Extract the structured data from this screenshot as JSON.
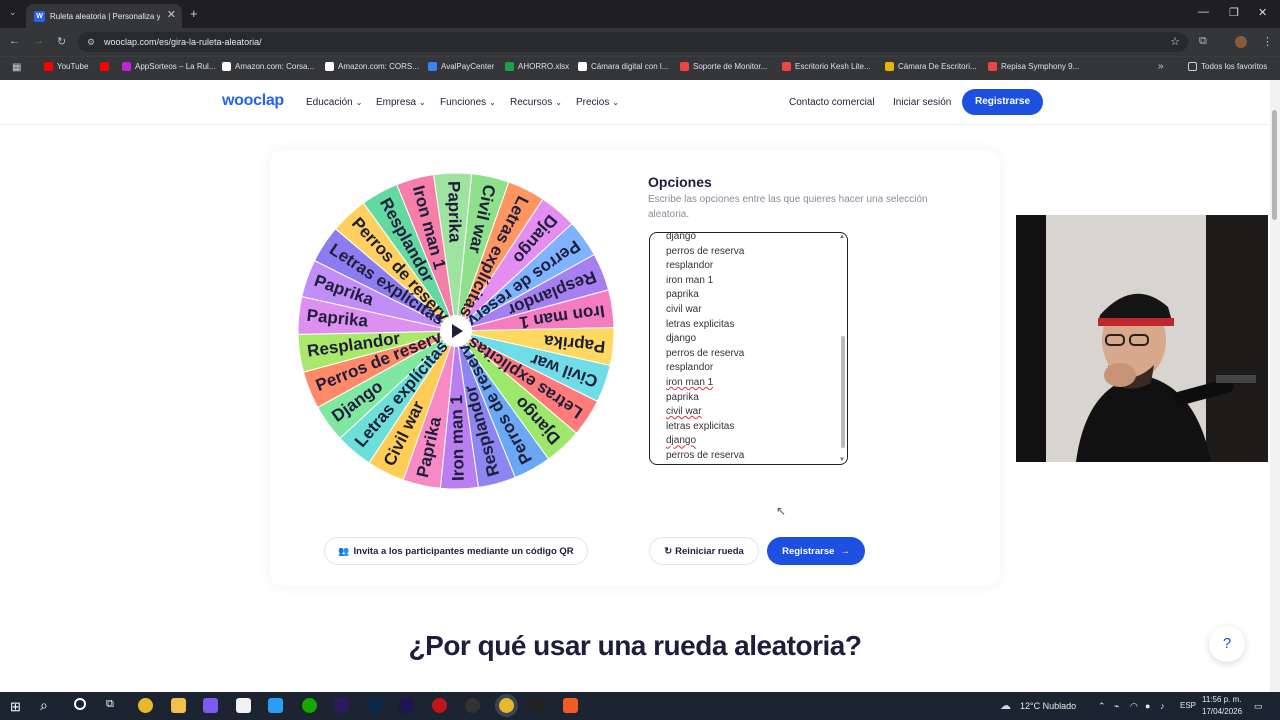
{
  "browser": {
    "tab_title": "Ruleta aleatoria | Personaliza y...",
    "tab_favicon": "W",
    "url": "wooclap.com/es/gira-la-ruleta-aleatoria/",
    "bookmarks": [
      {
        "label": "YouTube",
        "color": "#ff0000"
      },
      {
        "label": "",
        "color": "#ff0000"
      },
      {
        "label": "AppSorteos – La Rul...",
        "color": "#c026d3"
      },
      {
        "label": "Amazon.com: Corsa...",
        "color": "#ffffff"
      },
      {
        "label": "Amazon.com: CORS...",
        "color": "#ffffff"
      },
      {
        "label": "AvalPayCenter",
        "color": "#3b82f6"
      },
      {
        "label": "AHORRO.xlsx",
        "color": "#16a34a"
      },
      {
        "label": "Cámara digital con l...",
        "color": "#ffffff"
      },
      {
        "label": "Soporte de Monitor...",
        "color": "#ef4444"
      },
      {
        "label": "Escritorio Kesh Lite...",
        "color": "#ef4444"
      },
      {
        "label": "Cámara De Escritori...",
        "color": "#eab308"
      },
      {
        "label": "Repisa Symphony 9...",
        "color": "#ef4444"
      }
    ],
    "all_favorites": "Todos los favoritos"
  },
  "nav": {
    "logo": "wooclap",
    "items": [
      "Educación",
      "Empresa",
      "Funciones",
      "Recursos",
      "Precios"
    ],
    "contact": "Contacto comercial",
    "login": "Iniciar sesión",
    "register": "Registrarse"
  },
  "wheel": {
    "segments": [
      {
        "label": "Civil war",
        "color": "#8fe08a"
      },
      {
        "label": "Letras explícitas",
        "color": "#ff9560"
      },
      {
        "label": "Django",
        "color": "#e38ef0"
      },
      {
        "label": "Perros de reserva",
        "color": "#7fb2ff"
      },
      {
        "label": "Resplandor",
        "color": "#a77ff0"
      },
      {
        "label": "Iron man 1",
        "color": "#f57cc0"
      },
      {
        "label": "Paprika",
        "color": "#ffd860"
      },
      {
        "label": "Civil war",
        "color": "#6fdde8"
      },
      {
        "label": "Letras explícitas",
        "color": "#ff7a7a"
      },
      {
        "label": "Django",
        "color": "#9ce86a"
      },
      {
        "label": "Perros de reserva",
        "color": "#6aa8f5"
      },
      {
        "label": "Resplandor",
        "color": "#8b86f0"
      },
      {
        "label": "Iron man 1",
        "color": "#b97ef0"
      },
      {
        "label": "Paprika",
        "color": "#f78ac4"
      },
      {
        "label": "Civil war",
        "color": "#ffcc55"
      },
      {
        "label": "Letras explícitas",
        "color": "#6ce0d8"
      },
      {
        "label": "Django",
        "color": "#7fe7a0"
      },
      {
        "label": "Perros de reserva",
        "color": "#ff8a6a"
      },
      {
        "label": "Resplandor",
        "color": "#a9e86a"
      },
      {
        "label": "Paprika",
        "color": "#de90f0"
      },
      {
        "label": "Paprika",
        "color": "#c08ef5"
      },
      {
        "label": "Letras explícitas",
        "color": "#8c7cf0"
      },
      {
        "label": "Perros de reserva",
        "color": "#ffd060"
      },
      {
        "label": "Resplandor",
        "color": "#62d9a0"
      },
      {
        "label": "Iron man 1",
        "color": "#f57fa8"
      },
      {
        "label": "Paprika",
        "color": "#9fe3a0"
      }
    ]
  },
  "options": {
    "title": "Opciones",
    "description": "Escribe las opciones entre las que quieres hacer una selección aleatoria.",
    "lines": [
      "django",
      "perros de reserva",
      "resplandor",
      "iron man 1",
      "paprika",
      "civil war",
      "letras explicitas",
      "django",
      "perros de reserva",
      "resplandor",
      "iron man 1",
      "paprika",
      "civil war",
      "letras explicitas",
      "django",
      "perros de reserva"
    ]
  },
  "actions": {
    "qr": "Invita a los participantes mediante un código QR",
    "reset": "Reiniciar rueda",
    "register": "Registrarse"
  },
  "section_heading": "¿Por qué usar una rueda aleatoria?",
  "help": "?",
  "taskbar": {
    "weather": "12°C  Nublado",
    "lang": "ESP",
    "time": "11:56 p. m.",
    "date": "17/04/2026"
  }
}
